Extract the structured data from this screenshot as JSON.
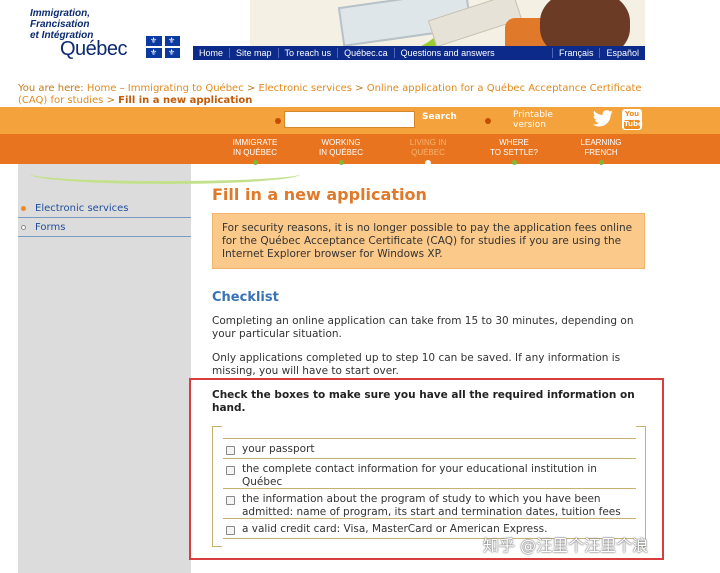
{
  "header": {
    "logo_lines": [
      "Immigration,",
      "Francisation",
      "et Intégration"
    ],
    "logo_name": "Québec"
  },
  "topnav": {
    "items": [
      "Home",
      "Site map",
      "To reach us",
      "Québec.ca",
      "Questions and answers"
    ],
    "languages": [
      "Français",
      "Español"
    ]
  },
  "breadcrumb": {
    "prefix": "You are here:",
    "links": [
      "Home",
      "Immigrating to Québec",
      "Electronic services",
      "Online application for a Québec Acceptance Certificate (CAQ) for studies"
    ],
    "separators": [
      " – ",
      " > ",
      " > ",
      " > "
    ],
    "current": "Fill in a new application"
  },
  "searchbar": {
    "search_placeholder": "",
    "search_label": "Search",
    "printable_label_1": "Printable",
    "printable_label_2": "version",
    "youtube_label_1": "You",
    "youtube_label_2": "Tube"
  },
  "mainnav": {
    "items": [
      {
        "line1": "IMMIGRATE",
        "line2": "IN QUÉBEC"
      },
      {
        "line1": "WORKING",
        "line2": "IN QUÉBEC"
      },
      {
        "line1": "LIVING IN",
        "line2": "QUÉBEC"
      },
      {
        "line1": "WHERE",
        "line2": "TO SETTLE?"
      },
      {
        "line1": "LEARNING",
        "line2": "FRENCH"
      }
    ]
  },
  "sidebar": {
    "items": [
      "Electronic services",
      "Forms"
    ]
  },
  "content": {
    "title": "Fill in a new application",
    "notice": "For security reasons, it is no longer possible to pay the application fees online for the Québec Acceptance Certificate (CAQ) for studies if you are using the Internet Explorer browser for Windows XP.",
    "checklist_heading": "Checklist",
    "para1": "Completing an online application can take from 15 to 30 minutes, depending on your particular situation.",
    "para2": "Only applications completed up to step 10 can be saved. If any information is missing, you will have to start over.",
    "check_title": "Check the boxes to make sure you have all the required information on hand.",
    "checklist_items": [
      "your passport",
      "the complete contact information for your educational institution in Québec",
      "the information about the program of study to which you have been admitted: name of program, its start and termination dates, tuition fees",
      "a valid credit card: Visa, MasterCard or American Express."
    ]
  },
  "watermark": "知乎 @汪里个汪里个浪",
  "colors": {
    "orange": "#e8741f",
    "light_orange": "#f4a23c",
    "navy": "#0b2a8a",
    "title_orange": "#e0792a",
    "checklist_blue": "#3a73b5",
    "notice_bg": "#fbc98a",
    "highlight_red": "#d93e3e"
  }
}
